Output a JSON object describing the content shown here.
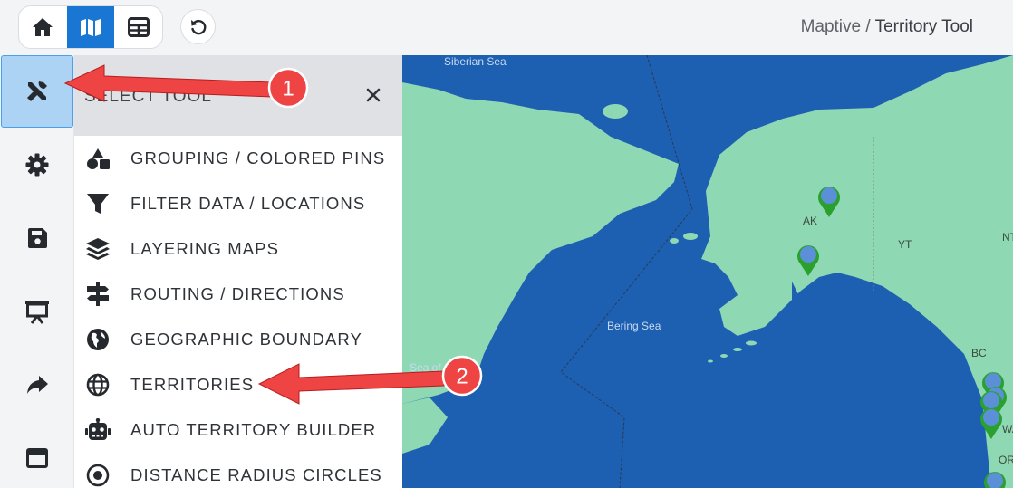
{
  "header": {
    "breadcrumb_app": "Maptive",
    "breadcrumb_sep": "/",
    "breadcrumb_page": "Territory Tool"
  },
  "view_toggle": {
    "items": [
      {
        "icon": "home-icon",
        "active": false
      },
      {
        "icon": "map-icon",
        "active": true
      },
      {
        "icon": "table-icon",
        "active": false
      }
    ]
  },
  "rail": {
    "items": [
      {
        "icon": "tools-icon",
        "active": true
      },
      {
        "icon": "gear-icon",
        "active": false
      },
      {
        "icon": "save-icon",
        "active": false
      },
      {
        "icon": "presentation-icon",
        "active": false
      },
      {
        "icon": "share-icon",
        "active": false
      },
      {
        "icon": "window-icon",
        "active": false
      }
    ]
  },
  "panel": {
    "title": "SELECT TOOL",
    "tools": [
      {
        "label": "GROUPING / COLORED PINS",
        "icon": "shapes-icon"
      },
      {
        "label": "FILTER DATA / LOCATIONS",
        "icon": "funnel-icon"
      },
      {
        "label": "LAYERING MAPS",
        "icon": "layers-icon"
      },
      {
        "label": "ROUTING / DIRECTIONS",
        "icon": "signpost-icon"
      },
      {
        "label": "GEOGRAPHIC BOUNDARY",
        "icon": "globe-americas-icon"
      },
      {
        "label": "TERRITORIES",
        "icon": "globe-grid-icon"
      },
      {
        "label": "AUTO TERRITORY BUILDER",
        "icon": "robot-icon"
      },
      {
        "label": "DISTANCE RADIUS CIRCLES",
        "icon": "radio-circle-icon"
      }
    ]
  },
  "map": {
    "labels": {
      "siberian_sea": "Siberian Sea",
      "bering_sea": "Bering Sea",
      "sea_of": "Sea of",
      "ak": "AK",
      "yt": "YT",
      "nt": "NT",
      "bc": "BC",
      "wa": "WA",
      "or": "OR"
    },
    "colors": {
      "water": "#1d5fb0",
      "land": "#8ed8b4",
      "pin": "#2aa12e",
      "pin_fill": "#5b8fd8"
    }
  },
  "annotations": {
    "badge_1": "1",
    "badge_2": "2",
    "color": "#ef4444"
  }
}
